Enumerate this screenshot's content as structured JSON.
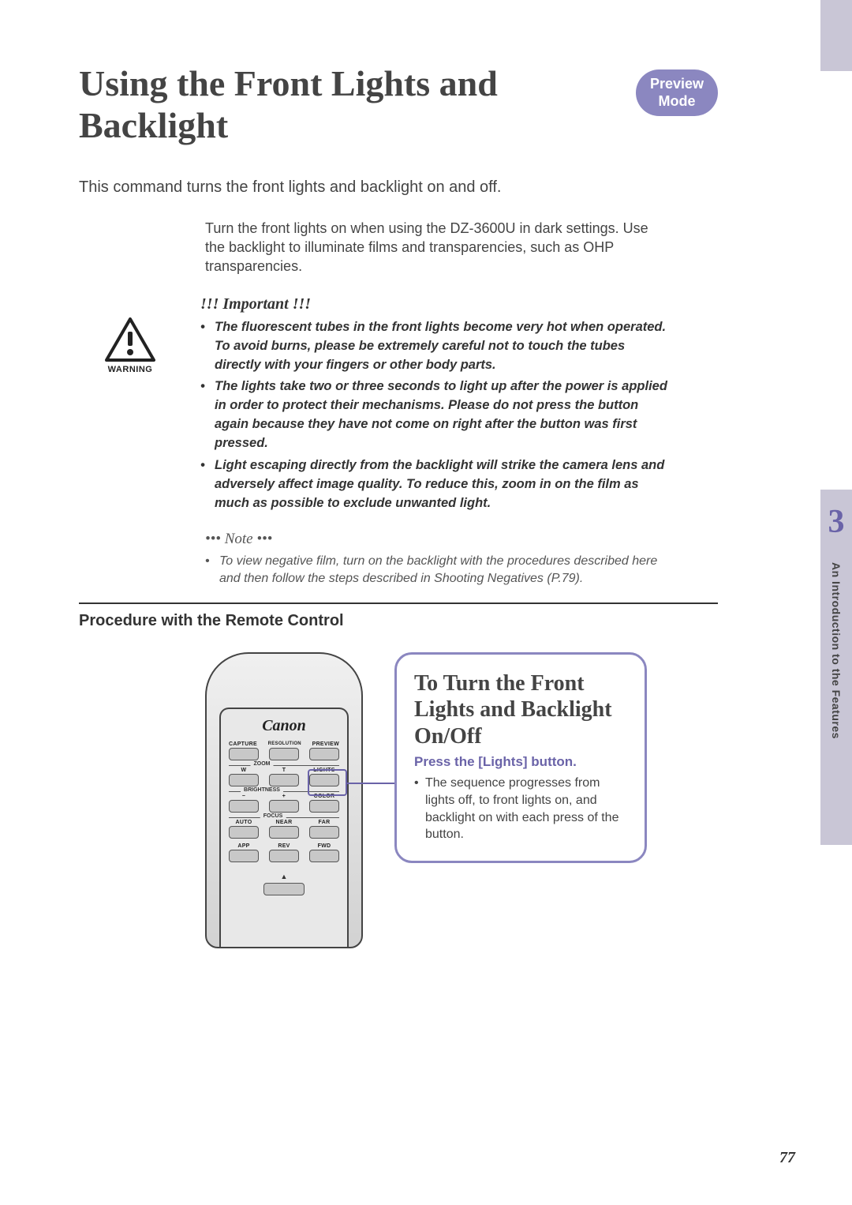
{
  "mode_badge": "Preview\nMode",
  "title": "Using the Front Lights and Backlight",
  "intro1": "This command turns the front lights and backlight on and off.",
  "intro2": "Turn the front lights on when using the DZ-3600U in dark settings. Use the backlight to illuminate films and transparencies, such as OHP transparencies.",
  "warning_label": "WARNING",
  "important": {
    "heading": "!!! Important !!!",
    "items": [
      "The fluorescent tubes in the front lights become very hot when operated. To avoid burns, please be extremely careful not to touch the tubes directly with your fingers or other body parts.",
      "The lights take two or three seconds to light up after the power is applied in order to protect their mechanisms. Please do not press the button again because they have not come on right after the button was first pressed.",
      "Light escaping directly from the backlight will strike the camera lens and adversely affect image quality. To reduce this, zoom in on the film as much as possible to exclude unwanted light."
    ]
  },
  "note": {
    "heading": "••• Note •••",
    "items": [
      "To view negative film, turn on the backlight with the procedures described here and then follow the steps described in Shooting Negatives (P.79)."
    ]
  },
  "procedure_heading": "Procedure with the Remote Control",
  "remote": {
    "brand": "Canon",
    "row1": [
      "CAPTURE",
      "RESOLUTION",
      "PREVIEW"
    ],
    "zoom": {
      "label": "ZOOM",
      "left": "W",
      "right": "T",
      "side": "LIGHTS"
    },
    "brightness": {
      "label": "BRIGHTNESS",
      "left": "−",
      "right": "+",
      "side": "COLOR"
    },
    "focus": {
      "label": "FOCUS",
      "a": "AUTO",
      "b": "NEAR",
      "c": "FAR"
    },
    "row_bottom": [
      "APP",
      "REV",
      "FWD"
    ]
  },
  "callout": {
    "title": "To Turn the Front Lights and Backlight On/Off",
    "sub": "Press the [Lights] button.",
    "body": "The sequence progresses from lights off, to front lights on, and backlight on with each press of the button."
  },
  "side": {
    "chapter_number": "3",
    "chapter_title": "An Introduction to the Features"
  },
  "page_number": "77"
}
